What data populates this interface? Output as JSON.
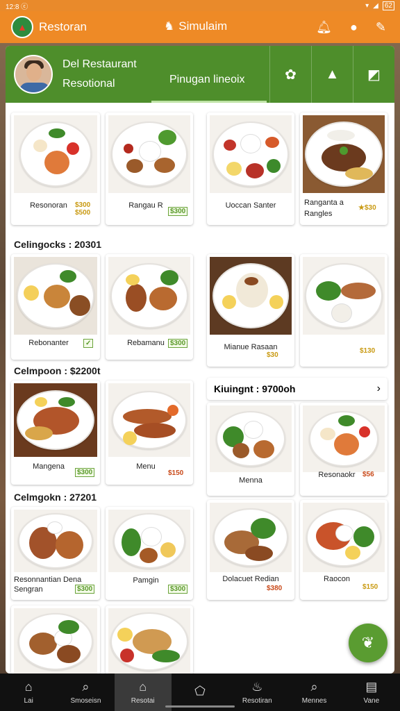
{
  "status": {
    "time": "12:8 ⓒ",
    "battery": "62"
  },
  "appbar": {
    "title": "Restoran",
    "center": "Simulaim"
  },
  "header": {
    "name": "Del Restaurant",
    "subtitle": "Resotional",
    "tab": "Pinugan lineoix"
  },
  "grid1": [
    {
      "name": "Resonoran",
      "price": "$300\n$500"
    },
    {
      "name": "Rangau R",
      "price": "$300"
    },
    {
      "name": "Uoccan Santer",
      "price": ""
    },
    {
      "name": "Ranganta a Rangles",
      "price": "★$30"
    }
  ],
  "section1": "Celingocks : 20301",
  "grid2": [
    {
      "name": "Rebonanter",
      "price": "✓"
    },
    {
      "name": "Rebamanu",
      "price": "$300"
    },
    {
      "name": "Mianue Rasaan",
      "price": "$30"
    },
    {
      "name": "",
      "price": "$130"
    }
  ],
  "section2": "Celmpoon : $2200t",
  "section2b": "Kiuingnt : 9700oh",
  "grid3": [
    {
      "name": "Mangena",
      "price": "$300"
    },
    {
      "name": "Menu",
      "price": "$150"
    },
    {
      "name": "Menna",
      "price": ""
    },
    {
      "name": "Resonaokr",
      "price": "$56"
    }
  ],
  "section3": "Celmgokn : 27201",
  "grid4": [
    {
      "name": "Resonnantian Dena Sengran",
      "price": "$300"
    },
    {
      "name": "Pamgin",
      "price": "$300"
    },
    {
      "name": "Dolacuet Redian",
      "price": "$380"
    },
    {
      "name": "Raocon",
      "price": "$150"
    }
  ],
  "nav": [
    "Lai",
    "Smoseisn",
    "Resotai",
    "",
    "Resotiran",
    "Mennes",
    "Vane"
  ]
}
